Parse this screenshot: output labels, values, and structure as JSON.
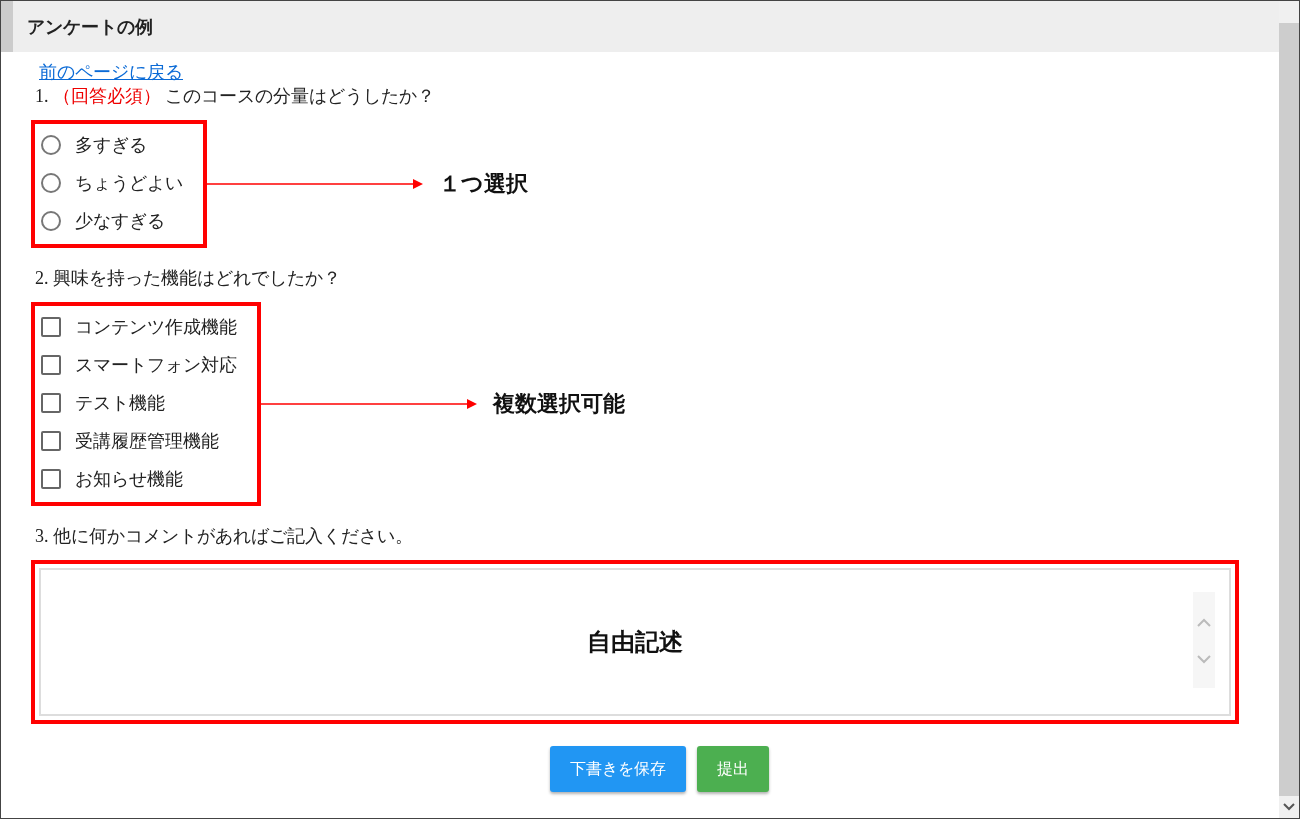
{
  "header": {
    "title": "アンケートの例"
  },
  "back_link": "前のページに戻る",
  "questions": [
    {
      "kind": "radio",
      "number": "1.",
      "required_mark": "（回答必須）",
      "text": "このコースの分量はどうしたか？",
      "annotation": "１つ選択",
      "options": [
        {
          "label": "多すぎる",
          "checked": false
        },
        {
          "label": "ちょうどよい",
          "checked": false
        },
        {
          "label": "少なすぎる",
          "checked": false
        }
      ]
    },
    {
      "kind": "checkbox",
      "number": "2.",
      "text": "興味を持った機能はどれでしたか？",
      "annotation": "複数選択可能",
      "options": [
        {
          "label": "コンテンツ作成機能",
          "checked": false
        },
        {
          "label": "スマートフォン対応",
          "checked": false
        },
        {
          "label": "テスト機能",
          "checked": false
        },
        {
          "label": "受講履歴管理機能",
          "checked": false
        },
        {
          "label": "お知らせ機能",
          "checked": false
        }
      ]
    },
    {
      "kind": "text",
      "number": "3.",
      "text": "他に何かコメントがあればご記入ください。",
      "annotation": "自由記述"
    }
  ],
  "buttons": [
    {
      "label": "下書きを保存",
      "kind": "primary"
    },
    {
      "label": "提出",
      "kind": "success"
    }
  ]
}
